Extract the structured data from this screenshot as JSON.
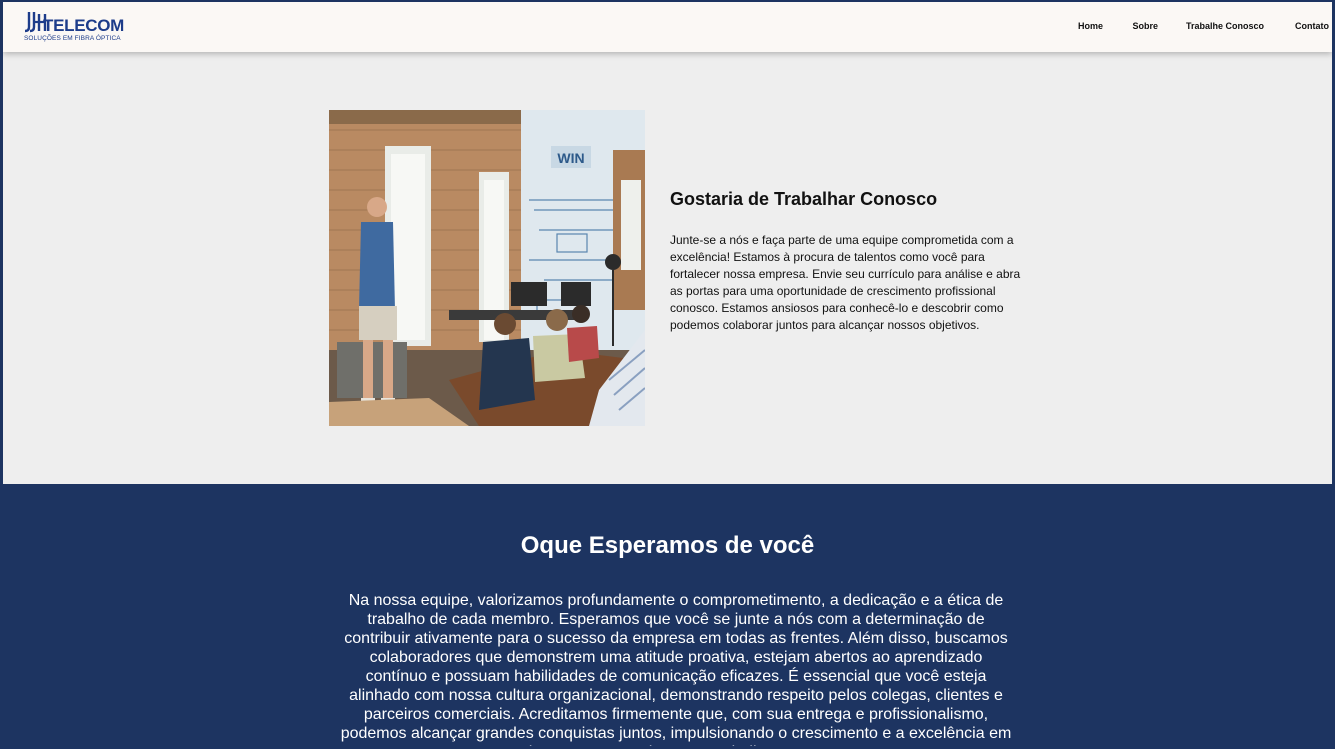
{
  "header": {
    "logo_text": "TELECOM",
    "logo_tagline": "SOLUÇÕES EM FIBRA ÓPTICA",
    "nav": [
      {
        "label": "Home"
      },
      {
        "label": "Sobre"
      },
      {
        "label": "Trabalhe Conosco"
      },
      {
        "label": "Contato"
      }
    ]
  },
  "hero": {
    "title": "Gostaria de Trabalhar Conosco",
    "text": "Junte-se a nós e faça parte de uma equipe comprometida com a excelência! Estamos à procura de talentos como você para fortalecer nossa empresa. Envie seu currículo para análise e abra as portas para uma oportunidade de crescimento profissional conosco. Estamos ansiosos para conhecê-lo e descobrir como podemos colaborar juntos para alcançar nossos objetivos.",
    "photo_sign": "WIN"
  },
  "expect": {
    "title": "Oque Esperamos de você",
    "text": "Na nossa equipe, valorizamos profundamente o comprometimento, a dedicação e a ética de trabalho de cada membro. Esperamos que você se junte a nós com a determinação de contribuir ativamente para o sucesso da empresa em todas as frentes. Além disso, buscamos colaboradores que demonstrem uma atitude proativa, estejam abertos ao aprendizado contínuo e possuam habilidades de comunicação eficazes. É essencial que você esteja alinhado com nossa cultura organizacional, demonstrando respeito pelos colegas, clientes e parceiros comerciais. Acreditamos firmemente que, com sua entrega e profissionalismo, podemos alcançar grandes conquistas juntos, impulsionando o crescimento e a excelência em todos os aspectos do nosso trabalho. Estamos"
  },
  "colors": {
    "brand": "#1d3c8a",
    "section_bg": "#1d3461",
    "hero_bg": "#eeeeee",
    "header_bg": "#fbf8f5"
  }
}
